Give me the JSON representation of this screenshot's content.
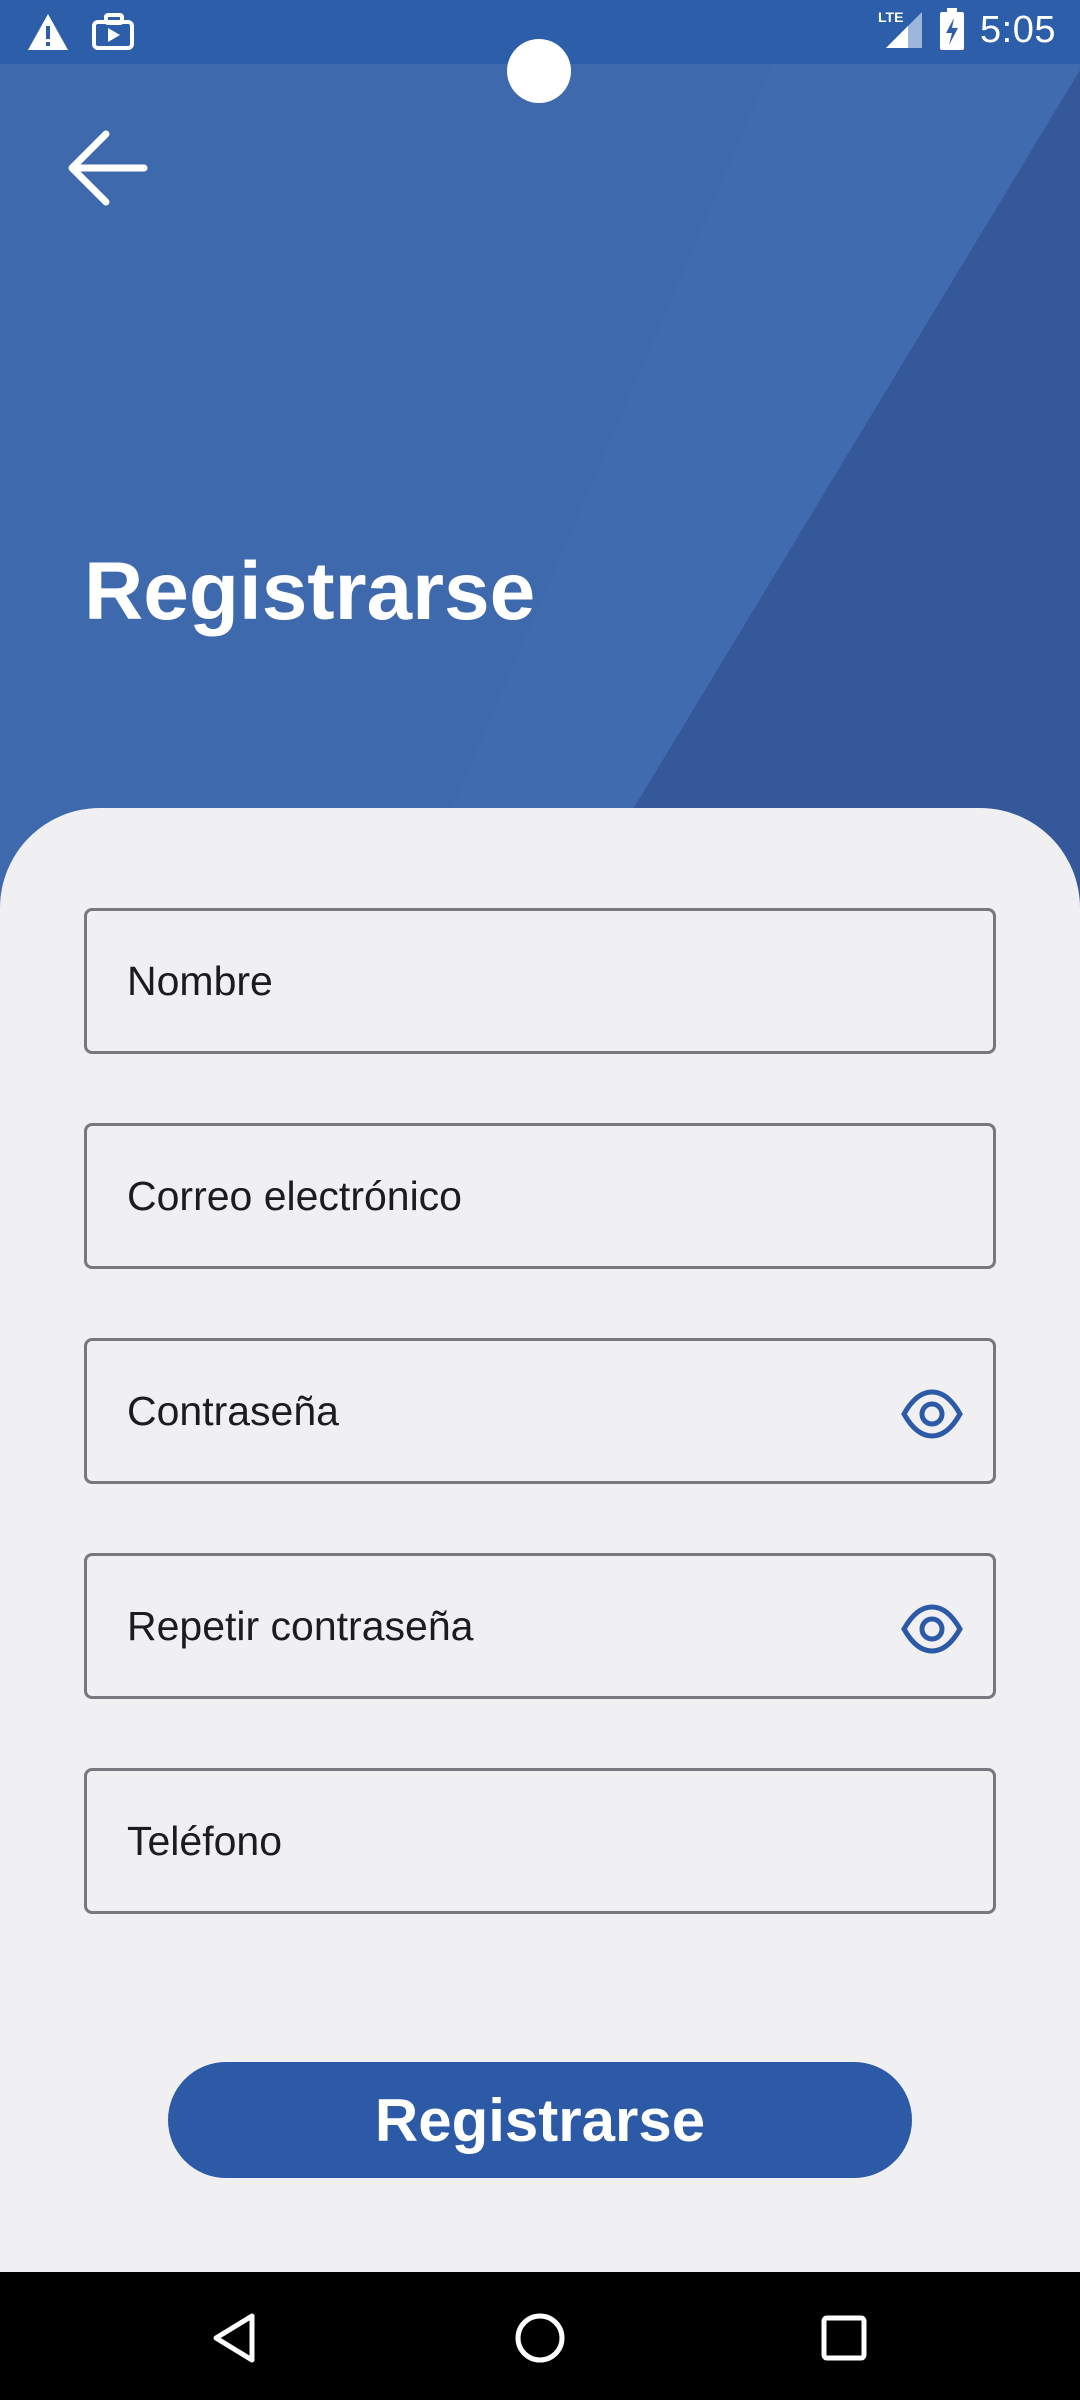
{
  "status_bar": {
    "time": "5:05",
    "network": "LTE",
    "icons": [
      "warning-icon",
      "briefcase-play-icon",
      "signal-icon",
      "battery-charging-icon"
    ]
  },
  "header": {
    "back_icon": "arrow-back-icon",
    "title": "Registrarse"
  },
  "form": {
    "name_placeholder": "Nombre",
    "email_placeholder": "Correo electrónico",
    "password_placeholder": "Contraseña",
    "repeat_password_placeholder": "Repetir contraseña",
    "phone_placeholder": "Teléfono",
    "visibility_icon": "eye-icon"
  },
  "actions": {
    "submit_label": "Registrarse"
  },
  "nav_bar": {
    "icons": [
      "back-triangle-icon",
      "home-circle-icon",
      "recents-square-icon"
    ]
  },
  "colors": {
    "primary": "#2C5AA7",
    "hero": "#3F69AD",
    "background": "#F0F0F2",
    "field_border": "#77777D"
  }
}
